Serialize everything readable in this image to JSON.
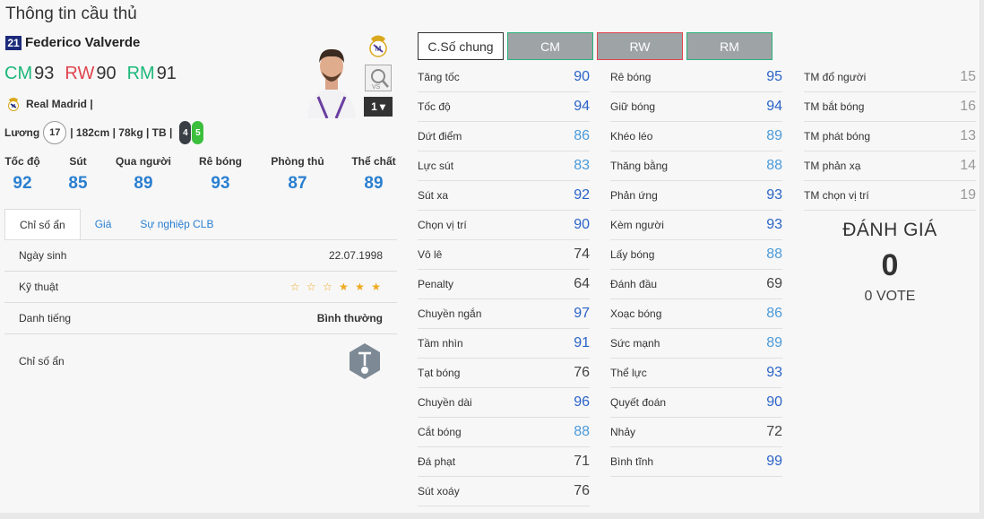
{
  "page_title": "Thông tin cầu thủ",
  "player": {
    "number": "21",
    "name": "Federico Valverde",
    "positions": [
      {
        "label": "CM",
        "value": "93",
        "color": "#1db87a"
      },
      {
        "label": "RW",
        "value": "90",
        "color": "#e0444f"
      },
      {
        "label": "RM",
        "value": "91",
        "color": "#1db87a"
      }
    ],
    "club": "Real Madrid |",
    "wage_label": "Lương",
    "wage": "17",
    "details": "| 182cm | 78kg | TB |",
    "weak_foot_left": "4",
    "weak_foot_right": "5",
    "level": "1"
  },
  "main_stats": [
    {
      "label": "Tốc độ",
      "value": "92"
    },
    {
      "label": "Sút",
      "value": "85"
    },
    {
      "label": "Qua người",
      "value": "89"
    },
    {
      "label": "Rê bóng",
      "value": "93"
    },
    {
      "label": "Phòng thủ",
      "value": "87"
    },
    {
      "label": "Thể chất",
      "value": "89"
    }
  ],
  "tabs": [
    "Chỉ số ẩn",
    "Giá",
    "Sự nghiệp CLB"
  ],
  "info": {
    "birth_label": "Ngày sinh",
    "birth_value": "22.07.1998",
    "skill_label": "Kỹ thuật",
    "skill_stars": "☆ ☆ ☆ ★ ★ ★",
    "fame_label": "Danh tiếng",
    "fame_value": "Bình thường",
    "hidden_label": "Chỉ số ẩn"
  },
  "selector_tabs": [
    "C.Số chung",
    "CM",
    "RW",
    "RM"
  ],
  "stats_col1": [
    {
      "label": "Tăng tốc",
      "value": "90",
      "tone": "blue"
    },
    {
      "label": "Tốc độ",
      "value": "94",
      "tone": "blue"
    },
    {
      "label": "Dứt điểm",
      "value": "86",
      "tone": "lblue"
    },
    {
      "label": "Lực sút",
      "value": "83",
      "tone": "lblue"
    },
    {
      "label": "Sút xa",
      "value": "92",
      "tone": "blue"
    },
    {
      "label": "Chọn vị trí",
      "value": "90",
      "tone": "blue"
    },
    {
      "label": "Vô lê",
      "value": "74",
      "tone": "dark"
    },
    {
      "label": "Penalty",
      "value": "64",
      "tone": "dark"
    },
    {
      "label": "Chuyền ngắn",
      "value": "97",
      "tone": "blue"
    },
    {
      "label": "Tầm nhìn",
      "value": "91",
      "tone": "blue"
    },
    {
      "label": "Tạt bóng",
      "value": "76",
      "tone": "dark"
    },
    {
      "label": "Chuyền dài",
      "value": "96",
      "tone": "blue"
    },
    {
      "label": "Cắt bóng",
      "value": "88",
      "tone": "lblue"
    },
    {
      "label": "Đá phạt",
      "value": "71",
      "tone": "dark"
    },
    {
      "label": "Sút xoáy",
      "value": "76",
      "tone": "dark"
    }
  ],
  "stats_col2": [
    {
      "label": "Rê bóng",
      "value": "95",
      "tone": "blue"
    },
    {
      "label": "Giữ bóng",
      "value": "94",
      "tone": "blue"
    },
    {
      "label": "Khéo léo",
      "value": "89",
      "tone": "lblue"
    },
    {
      "label": "Thăng bằng",
      "value": "88",
      "tone": "lblue"
    },
    {
      "label": "Phản ứng",
      "value": "93",
      "tone": "blue"
    },
    {
      "label": "Kèm người",
      "value": "93",
      "tone": "blue"
    },
    {
      "label": "Lấy bóng",
      "value": "88",
      "tone": "lblue"
    },
    {
      "label": "Đánh đầu",
      "value": "69",
      "tone": "dark"
    },
    {
      "label": "Xoạc bóng",
      "value": "86",
      "tone": "lblue"
    },
    {
      "label": "Sức mạnh",
      "value": "89",
      "tone": "lblue"
    },
    {
      "label": "Thể lực",
      "value": "93",
      "tone": "blue"
    },
    {
      "label": "Quyết đoán",
      "value": "90",
      "tone": "blue"
    },
    {
      "label": "Nhảy",
      "value": "72",
      "tone": "dark"
    },
    {
      "label": "Bình tĩnh",
      "value": "99",
      "tone": "blue"
    }
  ],
  "stats_col3": [
    {
      "label": "TM đổ người",
      "value": "15",
      "tone": "gray"
    },
    {
      "label": "TM bắt bóng",
      "value": "16",
      "tone": "gray"
    },
    {
      "label": "TM phát bóng",
      "value": "13",
      "tone": "gray"
    },
    {
      "label": "TM phản xạ",
      "value": "14",
      "tone": "gray"
    },
    {
      "label": "TM chọn vị trí",
      "value": "19",
      "tone": "gray"
    }
  ],
  "rating": {
    "title": "ĐÁNH GIÁ",
    "score": "0",
    "votes": "0 VOTE"
  }
}
